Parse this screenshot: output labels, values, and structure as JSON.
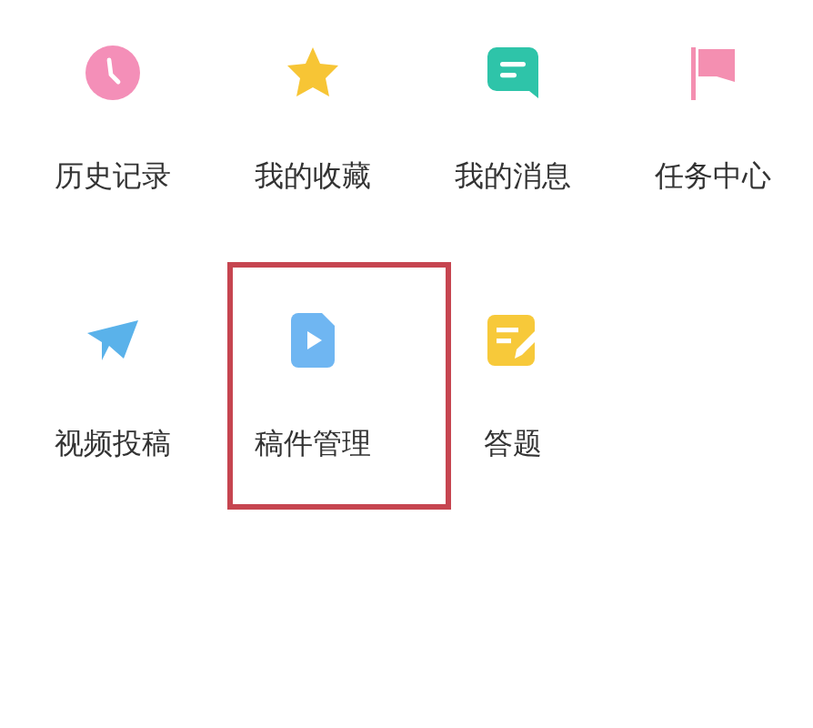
{
  "items": [
    {
      "label": "历史记录",
      "highlighted": false
    },
    {
      "label": "我的收藏",
      "highlighted": false
    },
    {
      "label": "我的消息",
      "highlighted": false
    },
    {
      "label": "任务中心",
      "highlighted": false
    },
    {
      "label": "视频投稿",
      "highlighted": false
    },
    {
      "label": "稿件管理",
      "highlighted": true
    },
    {
      "label": "答题",
      "highlighted": false
    }
  ]
}
